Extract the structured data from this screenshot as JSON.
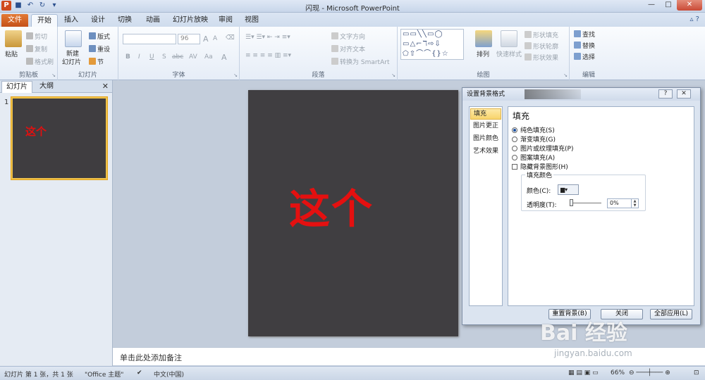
{
  "window": {
    "title": "闪现 - Microsoft PowerPoint"
  },
  "tabs": [
    "文件",
    "开始",
    "插入",
    "设计",
    "切换",
    "动画",
    "幻灯片放映",
    "审阅",
    "视图"
  ],
  "ribbon": {
    "clipboard": {
      "paste": "粘贴",
      "cut": "剪切",
      "copy": "复制",
      "format_painter": "格式刷",
      "label": "剪贴板"
    },
    "slides": {
      "new_slide": "新建",
      "new_slide2": "幻灯片",
      "layout": "版式",
      "reset": "重设",
      "section": "节",
      "label": "幻灯片"
    },
    "font": {
      "size": "96",
      "bold": "B",
      "italic": "I",
      "underline": "U",
      "strike": "S",
      "shadow": "abc",
      "spacing": "AV",
      "case": "Aa",
      "grow": "A",
      "shrink": "A",
      "label": "字体"
    },
    "paragraph": {
      "text_direction": "文字方向",
      "align_text": "对齐文本",
      "smartart": "转换为 SmartArt",
      "label": "段落"
    },
    "drawing": {
      "arrange": "排列",
      "quick_styles": "快速样式",
      "shape_fill": "形状填充",
      "shape_outline": "形状轮廓",
      "shape_effects": "形状效果",
      "label": "绘图"
    },
    "editing": {
      "find": "查找",
      "replace": "替换",
      "select": "选择",
      "label": "编辑"
    }
  },
  "pane": {
    "tab_slides": "幻灯片",
    "tab_outline": "大纲",
    "thumb_number": "1",
    "thumb_text": "这个"
  },
  "slide": {
    "text": "这个",
    "background": "#403e41",
    "text_color": "#e41010"
  },
  "notes": {
    "placeholder": "单击此处添加备注"
  },
  "status": {
    "slide_info": "幻灯片 第 1 张，共 1 张",
    "theme": "\"Office 主题\"",
    "language": "中文(中国)",
    "zoom": "66%"
  },
  "dialog": {
    "title": "设置背景格式",
    "nav": [
      "填充",
      "图片更正",
      "图片颜色",
      "艺术效果"
    ],
    "heading": "填充",
    "options": [
      {
        "label": "纯色填充(S)",
        "checked": true
      },
      {
        "label": "渐变填充(G)",
        "checked": false
      },
      {
        "label": "图片或纹理填充(P)",
        "checked": false
      },
      {
        "label": "图案填充(A)",
        "checked": false
      }
    ],
    "hide_graphics": "隐藏背景图形(H)",
    "fill_color_legend": "填充颜色",
    "color_label": "颜色(C):",
    "transparency_label": "透明度(T):",
    "transparency_value": "0%",
    "buttons": {
      "reset": "重置背景(B)",
      "close": "关闭",
      "apply_all": "全部应用(L)"
    }
  },
  "watermark": {
    "brand": "Bai 经验",
    "url": "jingyan.baidu.com"
  }
}
